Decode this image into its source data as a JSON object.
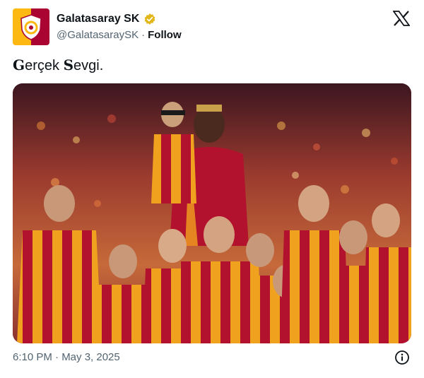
{
  "account": {
    "display_name": "Galatasaray SK",
    "handle": "@GalatasaraySK",
    "separator": "·",
    "follow_label": "Follow",
    "verified": true,
    "brand_yellow": "#fdb912",
    "brand_red": "#a90432",
    "verified_color": "#e2b719"
  },
  "tweet": {
    "text_cap1": "G",
    "text_part1": "erçek ",
    "text_cap2": "S",
    "text_part2": "evgi."
  },
  "meta": {
    "timestamp": "6:10 PM · May 3, 2025"
  },
  "icons": {
    "logo": "x-logo-icon",
    "info": "info-icon",
    "verified": "verified-badge-icon"
  }
}
